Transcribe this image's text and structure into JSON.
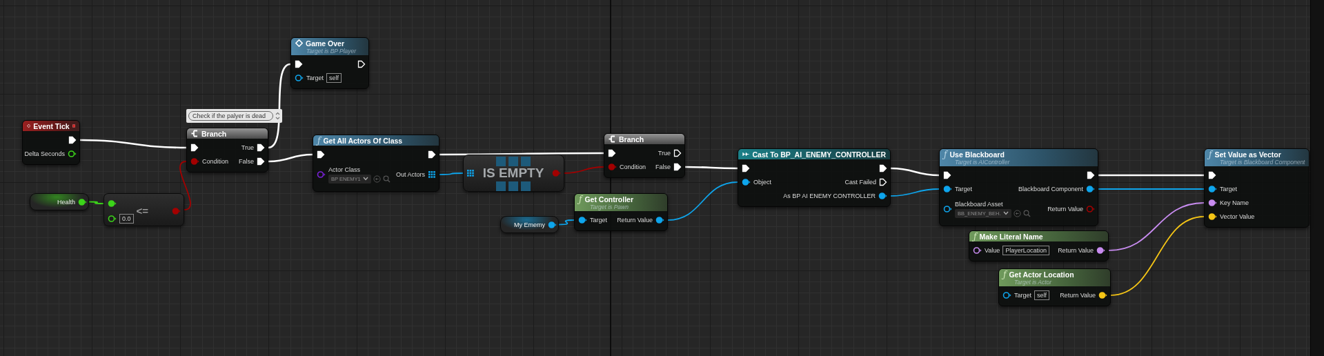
{
  "nodes": [
    {
      "kind": "event",
      "title": "Event Tick",
      "outputs": [
        {
          "kind": "exec",
          "connected": true
        },
        {
          "kind": "float",
          "label": "Delta Seconds",
          "connected": false
        }
      ]
    },
    {
      "kind": "comment",
      "text": "Check if the palyer is dead"
    },
    {
      "kind": "branch",
      "title": "Branch",
      "inputs": [
        {
          "kind": "exec",
          "connected": true
        },
        {
          "kind": "bool",
          "label": "Condition",
          "connected": true
        }
      ],
      "outputs": [
        {
          "kind": "exec",
          "label": "True",
          "connected": true
        },
        {
          "kind": "exec",
          "label": "False",
          "connected": true
        }
      ]
    },
    {
      "kind": "function",
      "title": "Game Over",
      "subtitle": "Target is BP Player",
      "inputs": [
        {
          "kind": "exec",
          "connected": true
        },
        {
          "kind": "object",
          "label": "Target",
          "connected": false,
          "default": {
            "kind": "text",
            "value": "self"
          }
        }
      ],
      "outputs": [
        {
          "kind": "exec",
          "connected": false
        }
      ]
    },
    {
      "kind": "variable",
      "label": "Health",
      "outputs": [
        {
          "kind": "float",
          "connected": true
        }
      ]
    },
    {
      "kind": "operator",
      "symbol": "<=",
      "inputs": [
        {
          "kind": "float",
          "connected": true
        },
        {
          "kind": "float",
          "connected": false,
          "default": {
            "kind": "text",
            "value": "0.0"
          }
        }
      ],
      "outputs": [
        {
          "kind": "bool",
          "connected": true
        }
      ]
    },
    {
      "kind": "function",
      "glyph": "ƒ",
      "title": "Get All Actors Of Class",
      "inputs": [
        {
          "kind": "exec",
          "connected": true
        },
        {
          "kind": "class",
          "label": "Actor Class",
          "connected": false,
          "default": {
            "kind": "dropdown",
            "value": "BP ENEMY1"
          }
        }
      ],
      "outputs": [
        {
          "kind": "exec",
          "connected": true
        },
        {
          "kind": "array",
          "label": "Out Actors",
          "connected": true
        }
      ]
    },
    {
      "kind": "macro",
      "label": "IS EMPTY",
      "inputs": [
        {
          "kind": "array",
          "connected": true
        }
      ],
      "outputs": [
        {
          "kind": "bool",
          "connected": true
        }
      ]
    },
    {
      "kind": "branch",
      "title": "Branch",
      "inputs": [
        {
          "kind": "exec",
          "connected": true
        },
        {
          "kind": "bool",
          "label": "Condition",
          "connected": true
        }
      ],
      "outputs": [
        {
          "kind": "exec",
          "label": "True",
          "connected": false
        },
        {
          "kind": "exec",
          "label": "False",
          "connected": true
        }
      ]
    },
    {
      "kind": "pure_function",
      "glyph": "ƒ",
      "title": "Get Controller",
      "subtitle": "Target is Pawn",
      "inputs": [
        {
          "kind": "object",
          "label": "Target",
          "connected": true
        }
      ],
      "outputs": [
        {
          "kind": "object",
          "label": "Return Value",
          "connected": true
        }
      ]
    },
    {
      "kind": "variable",
      "label": "My Ememy",
      "outputs": [
        {
          "kind": "object",
          "connected": true
        }
      ]
    },
    {
      "kind": "cast",
      "title": "Cast To BP_AI_ENEMY_CONTROLLER",
      "inputs": [
        {
          "kind": "exec",
          "connected": true
        },
        {
          "kind": "object",
          "label": "Object",
          "connected": true
        }
      ],
      "outputs": [
        {
          "kind": "exec",
          "connected": true
        },
        {
          "kind": "exec",
          "label": "Cast Failed",
          "connected": false
        },
        {
          "kind": "object",
          "label": "As BP AI ENEMY CONTROLLER",
          "connected": true
        }
      ]
    },
    {
      "kind": "function",
      "glyph": "ƒ",
      "title": "Use Blackboard",
      "subtitle": "Target is AIController",
      "inputs": [
        {
          "kind": "exec",
          "connected": true
        },
        {
          "kind": "object",
          "label": "Target",
          "connected": true
        },
        {
          "kind": "object",
          "label": "Blackboard Asset",
          "connected": false,
          "default": {
            "kind": "dropdown",
            "value": "BB_ENEMY_BEH."
          }
        }
      ],
      "outputs": [
        {
          "kind": "exec",
          "connected": true
        },
        {
          "kind": "object",
          "label": "Blackboard Component",
          "connected": true
        },
        {
          "kind": "bool",
          "label": "Return Value",
          "connected": false
        }
      ]
    },
    {
      "kind": "function",
      "glyph": "ƒ",
      "title": "Set Value as Vector",
      "subtitle": "Target is Blackboard Component",
      "inputs": [
        {
          "kind": "exec",
          "connected": true
        },
        {
          "kind": "object",
          "label": "Target",
          "connected": true
        },
        {
          "kind": "name",
          "label": "Key Name",
          "connected": true
        },
        {
          "kind": "vector",
          "label": "Vector Value",
          "connected": true
        }
      ]
    },
    {
      "kind": "pure_function",
      "glyph": "ƒ",
      "title": "Make Literal Name",
      "inputs": [
        {
          "kind": "name",
          "label": "Value",
          "connected": false,
          "default": {
            "kind": "text",
            "value": "PlayerLocation"
          }
        }
      ],
      "outputs": [
        {
          "kind": "name",
          "label": "Return Value",
          "connected": true
        }
      ]
    },
    {
      "kind": "pure_function",
      "glyph": "ƒ",
      "title": "Get Actor Location",
      "subtitle": "Target is Actor",
      "inputs": [
        {
          "kind": "object",
          "label": "Target",
          "connected": false,
          "default": {
            "kind": "text",
            "value": "self"
          }
        }
      ],
      "outputs": [
        {
          "kind": "vector",
          "label": "Return Value",
          "connected": true
        }
      ]
    }
  ]
}
